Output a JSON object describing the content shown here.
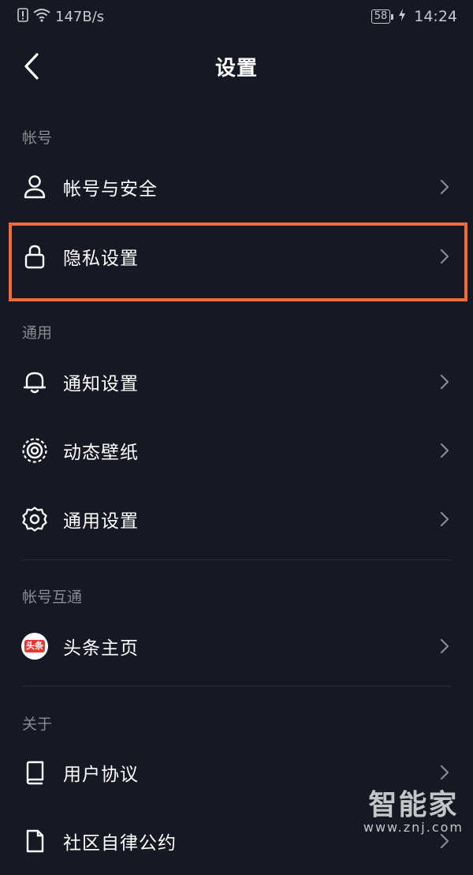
{
  "status_bar": {
    "network_speed": "147B/s",
    "battery_level": "58",
    "time": "14:24"
  },
  "header": {
    "title": "设置"
  },
  "sections": {
    "account": {
      "header": "帐号",
      "items": [
        {
          "label": "帐号与安全",
          "icon": "person-icon"
        },
        {
          "label": "隐私设置",
          "icon": "lock-icon"
        }
      ]
    },
    "general": {
      "header": "通用",
      "items": [
        {
          "label": "通知设置",
          "icon": "bell-icon"
        },
        {
          "label": "动态壁纸",
          "icon": "live-wallpaper-icon"
        },
        {
          "label": "通用设置",
          "icon": "gear-icon"
        }
      ]
    },
    "linked": {
      "header": "帐号互通",
      "items": [
        {
          "label": "头条主页",
          "icon": "toutiao-logo",
          "badge_text": "头条"
        }
      ]
    },
    "about": {
      "header": "关于",
      "items": [
        {
          "label": "用户协议",
          "icon": "book-icon"
        },
        {
          "label": "社区自律公约",
          "icon": "document-icon"
        }
      ]
    }
  },
  "highlight_color": "#f06a3b",
  "watermark": {
    "brand": "智能家",
    "url": "www.znj.com"
  }
}
